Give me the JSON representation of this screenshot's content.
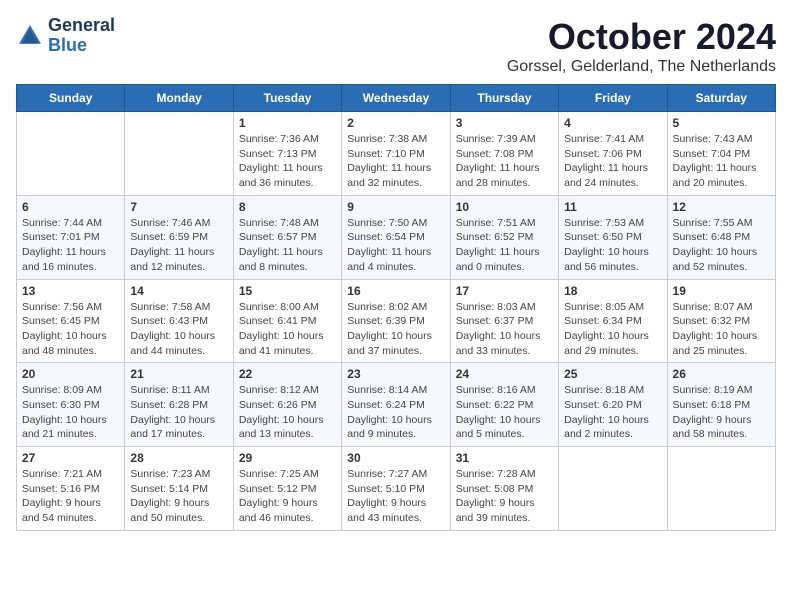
{
  "header": {
    "logo_line1": "General",
    "logo_line2": "Blue",
    "month_title": "October 2024",
    "location": "Gorssel, Gelderland, The Netherlands"
  },
  "days_of_week": [
    "Sunday",
    "Monday",
    "Tuesday",
    "Wednesday",
    "Thursday",
    "Friday",
    "Saturday"
  ],
  "weeks": [
    [
      {
        "day": "",
        "info": ""
      },
      {
        "day": "",
        "info": ""
      },
      {
        "day": "1",
        "info": "Sunrise: 7:36 AM\nSunset: 7:13 PM\nDaylight: 11 hours and 36 minutes."
      },
      {
        "day": "2",
        "info": "Sunrise: 7:38 AM\nSunset: 7:10 PM\nDaylight: 11 hours and 32 minutes."
      },
      {
        "day": "3",
        "info": "Sunrise: 7:39 AM\nSunset: 7:08 PM\nDaylight: 11 hours and 28 minutes."
      },
      {
        "day": "4",
        "info": "Sunrise: 7:41 AM\nSunset: 7:06 PM\nDaylight: 11 hours and 24 minutes."
      },
      {
        "day": "5",
        "info": "Sunrise: 7:43 AM\nSunset: 7:04 PM\nDaylight: 11 hours and 20 minutes."
      }
    ],
    [
      {
        "day": "6",
        "info": "Sunrise: 7:44 AM\nSunset: 7:01 PM\nDaylight: 11 hours and 16 minutes."
      },
      {
        "day": "7",
        "info": "Sunrise: 7:46 AM\nSunset: 6:59 PM\nDaylight: 11 hours and 12 minutes."
      },
      {
        "day": "8",
        "info": "Sunrise: 7:48 AM\nSunset: 6:57 PM\nDaylight: 11 hours and 8 minutes."
      },
      {
        "day": "9",
        "info": "Sunrise: 7:50 AM\nSunset: 6:54 PM\nDaylight: 11 hours and 4 minutes."
      },
      {
        "day": "10",
        "info": "Sunrise: 7:51 AM\nSunset: 6:52 PM\nDaylight: 11 hours and 0 minutes."
      },
      {
        "day": "11",
        "info": "Sunrise: 7:53 AM\nSunset: 6:50 PM\nDaylight: 10 hours and 56 minutes."
      },
      {
        "day": "12",
        "info": "Sunrise: 7:55 AM\nSunset: 6:48 PM\nDaylight: 10 hours and 52 minutes."
      }
    ],
    [
      {
        "day": "13",
        "info": "Sunrise: 7:56 AM\nSunset: 6:45 PM\nDaylight: 10 hours and 48 minutes."
      },
      {
        "day": "14",
        "info": "Sunrise: 7:58 AM\nSunset: 6:43 PM\nDaylight: 10 hours and 44 minutes."
      },
      {
        "day": "15",
        "info": "Sunrise: 8:00 AM\nSunset: 6:41 PM\nDaylight: 10 hours and 41 minutes."
      },
      {
        "day": "16",
        "info": "Sunrise: 8:02 AM\nSunset: 6:39 PM\nDaylight: 10 hours and 37 minutes."
      },
      {
        "day": "17",
        "info": "Sunrise: 8:03 AM\nSunset: 6:37 PM\nDaylight: 10 hours and 33 minutes."
      },
      {
        "day": "18",
        "info": "Sunrise: 8:05 AM\nSunset: 6:34 PM\nDaylight: 10 hours and 29 minutes."
      },
      {
        "day": "19",
        "info": "Sunrise: 8:07 AM\nSunset: 6:32 PM\nDaylight: 10 hours and 25 minutes."
      }
    ],
    [
      {
        "day": "20",
        "info": "Sunrise: 8:09 AM\nSunset: 6:30 PM\nDaylight: 10 hours and 21 minutes."
      },
      {
        "day": "21",
        "info": "Sunrise: 8:11 AM\nSunset: 6:28 PM\nDaylight: 10 hours and 17 minutes."
      },
      {
        "day": "22",
        "info": "Sunrise: 8:12 AM\nSunset: 6:26 PM\nDaylight: 10 hours and 13 minutes."
      },
      {
        "day": "23",
        "info": "Sunrise: 8:14 AM\nSunset: 6:24 PM\nDaylight: 10 hours and 9 minutes."
      },
      {
        "day": "24",
        "info": "Sunrise: 8:16 AM\nSunset: 6:22 PM\nDaylight: 10 hours and 5 minutes."
      },
      {
        "day": "25",
        "info": "Sunrise: 8:18 AM\nSunset: 6:20 PM\nDaylight: 10 hours and 2 minutes."
      },
      {
        "day": "26",
        "info": "Sunrise: 8:19 AM\nSunset: 6:18 PM\nDaylight: 9 hours and 58 minutes."
      }
    ],
    [
      {
        "day": "27",
        "info": "Sunrise: 7:21 AM\nSunset: 5:16 PM\nDaylight: 9 hours and 54 minutes."
      },
      {
        "day": "28",
        "info": "Sunrise: 7:23 AM\nSunset: 5:14 PM\nDaylight: 9 hours and 50 minutes."
      },
      {
        "day": "29",
        "info": "Sunrise: 7:25 AM\nSunset: 5:12 PM\nDaylight: 9 hours and 46 minutes."
      },
      {
        "day": "30",
        "info": "Sunrise: 7:27 AM\nSunset: 5:10 PM\nDaylight: 9 hours and 43 minutes."
      },
      {
        "day": "31",
        "info": "Sunrise: 7:28 AM\nSunset: 5:08 PM\nDaylight: 9 hours and 39 minutes."
      },
      {
        "day": "",
        "info": ""
      },
      {
        "day": "",
        "info": ""
      }
    ]
  ]
}
